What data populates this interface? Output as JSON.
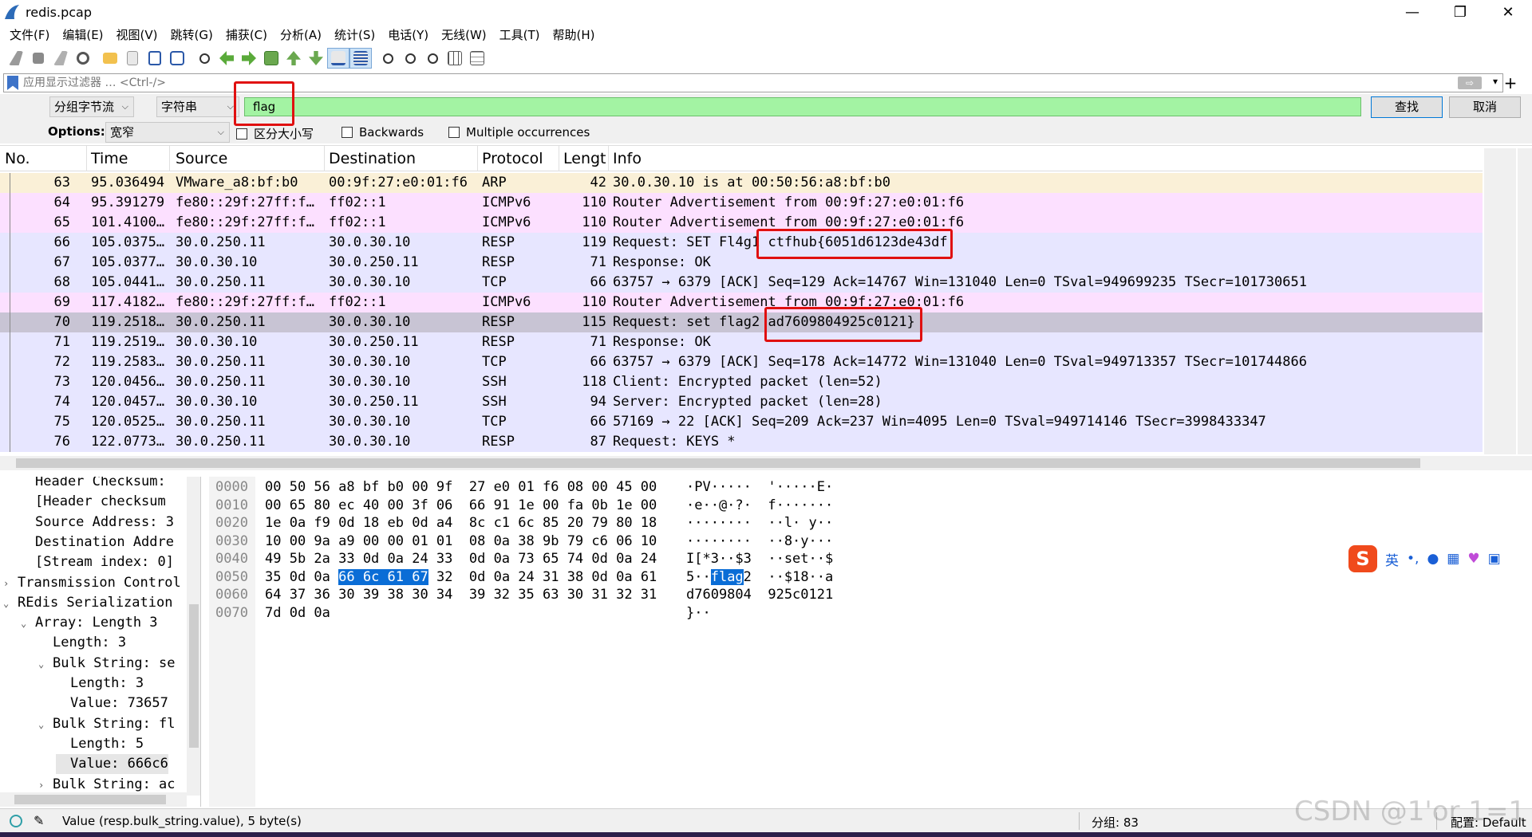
{
  "window": {
    "title": "redis.pcap",
    "controls": [
      "—",
      "❐",
      "✕"
    ]
  },
  "menu": [
    "文件(F)",
    "编辑(E)",
    "视图(V)",
    "跳转(G)",
    "捕获(C)",
    "分析(A)",
    "统计(S)",
    "电话(Y)",
    "无线(W)",
    "工具(T)",
    "帮助(H)"
  ],
  "filter": {
    "placeholder": "应用显示过滤器 … <Ctrl-/>",
    "apply_arrow": "⇨",
    "dropdown": "▾",
    "add": "+"
  },
  "find": {
    "scope": "分组字节流",
    "type": "字符串",
    "query": "flag",
    "find_label": "查找",
    "cancel_label": "取消",
    "options_label": "Options:",
    "charset": "宽窄",
    "case_label": "区分大小写",
    "backwards_label": "Backwards",
    "multiple_label": "Multiple occurrences"
  },
  "columns": [
    "No.",
    "Time",
    "Source",
    "Destination",
    "Protocol",
    "Lengt",
    "Info"
  ],
  "packets": [
    {
      "no": "63",
      "time": "95.036494",
      "src": "VMware_a8:bf:b0",
      "dst": "00:9f:27:e0:01:f6",
      "proto": "ARP",
      "len": "42",
      "info": "30.0.30.10 is at 00:50:56:a8:bf:b0",
      "bg": "#faf0d7"
    },
    {
      "no": "64",
      "time": "95.391279",
      "src": "fe80::29f:27ff:f…",
      "dst": "ff02::1",
      "proto": "ICMPv6",
      "len": "110",
      "info": "Router Advertisement from 00:9f:27:e0:01:f6",
      "bg": "#fce0ff"
    },
    {
      "no": "65",
      "time": "101.4100…",
      "src": "fe80::29f:27ff:f…",
      "dst": "ff02::1",
      "proto": "ICMPv6",
      "len": "110",
      "info": "Router Advertisement from 00:9f:27:e0:01:f6",
      "bg": "#fce0ff"
    },
    {
      "no": "66",
      "time": "105.0375…",
      "src": "30.0.250.11",
      "dst": "30.0.30.10",
      "proto": "RESP",
      "len": "119",
      "info": "Request: SET Fl4g1 ctfhub{6051d6123de43df",
      "bg": "#e7e6ff"
    },
    {
      "no": "67",
      "time": "105.0377…",
      "src": "30.0.30.10",
      "dst": "30.0.250.11",
      "proto": "RESP",
      "len": "71",
      "info": "Response: OK",
      "bg": "#e7e6ff"
    },
    {
      "no": "68",
      "time": "105.0441…",
      "src": "30.0.250.11",
      "dst": "30.0.30.10",
      "proto": "TCP",
      "len": "66",
      "info": "63757 → 6379 [ACK] Seq=129 Ack=14767 Win=131040 Len=0 TSval=949699235 TSecr=101730651",
      "bg": "#e7e6ff"
    },
    {
      "no": "69",
      "time": "117.4182…",
      "src": "fe80::29f:27ff:f…",
      "dst": "ff02::1",
      "proto": "ICMPv6",
      "len": "110",
      "info": "Router Advertisement from 00:9f:27:e0:01:f6",
      "bg": "#fce0ff"
    },
    {
      "no": "70",
      "time": "119.2518…",
      "src": "30.0.250.11",
      "dst": "30.0.30.10",
      "proto": "RESP",
      "len": "115",
      "info": "Request: set flag2 ad7609804925c0121}",
      "bg": "#c8c4d4"
    },
    {
      "no": "71",
      "time": "119.2519…",
      "src": "30.0.30.10",
      "dst": "30.0.250.11",
      "proto": "RESP",
      "len": "71",
      "info": "Response: OK",
      "bg": "#e7e6ff"
    },
    {
      "no": "72",
      "time": "119.2583…",
      "src": "30.0.250.11",
      "dst": "30.0.30.10",
      "proto": "TCP",
      "len": "66",
      "info": "63757 → 6379 [ACK] Seq=178 Ack=14772 Win=131040 Len=0 TSval=949713357 TSecr=101744866",
      "bg": "#e7e6ff"
    },
    {
      "no": "73",
      "time": "120.0456…",
      "src": "30.0.250.11",
      "dst": "30.0.30.10",
      "proto": "SSH",
      "len": "118",
      "info": "Client: Encrypted packet (len=52)",
      "bg": "#e7e6ff"
    },
    {
      "no": "74",
      "time": "120.0457…",
      "src": "30.0.30.10",
      "dst": "30.0.250.11",
      "proto": "SSH",
      "len": "94",
      "info": "Server: Encrypted packet (len=28)",
      "bg": "#e7e6ff"
    },
    {
      "no": "75",
      "time": "120.0525…",
      "src": "30.0.250.11",
      "dst": "30.0.30.10",
      "proto": "TCP",
      "len": "66",
      "info": "57169 → 22 [ACK] Seq=209 Ack=237 Win=4095 Len=0 TSval=949714146 TSecr=3998433347",
      "bg": "#e7e6ff"
    },
    {
      "no": "76",
      "time": "122.0773…",
      "src": "30.0.250.11",
      "dst": "30.0.30.10",
      "proto": "RESP",
      "len": "87",
      "info": "Request: KEYS *",
      "bg": "#e7e6ff"
    }
  ],
  "details": [
    {
      "indent": 2,
      "arrow": "",
      "text": "Header Checksum: "
    },
    {
      "indent": 2,
      "arrow": "",
      "text": "[Header checksum"
    },
    {
      "indent": 2,
      "arrow": "",
      "text": "Source Address: 3"
    },
    {
      "indent": 2,
      "arrow": "",
      "text": "Destination Addre"
    },
    {
      "indent": 2,
      "arrow": "",
      "text": "[Stream index: 0]"
    },
    {
      "indent": 1,
      "arrow": "›",
      "text": "Transmission Control"
    },
    {
      "indent": 1,
      "arrow": "⌄",
      "text": "REdis Serialization"
    },
    {
      "indent": 2,
      "arrow": "⌄",
      "text": "Array: Length 3"
    },
    {
      "indent": 3,
      "arrow": "",
      "text": "Length: 3"
    },
    {
      "indent": 3,
      "arrow": "⌄",
      "text": "Bulk String: se"
    },
    {
      "indent": 4,
      "arrow": "",
      "text": "Length: 3"
    },
    {
      "indent": 4,
      "arrow": "",
      "text": "Value: 73657"
    },
    {
      "indent": 3,
      "arrow": "⌄",
      "text": "Bulk String: fl"
    },
    {
      "indent": 4,
      "arrow": "",
      "text": "Length: 5"
    },
    {
      "indent": 4,
      "arrow": "",
      "text": "Value: 666c6"
    },
    {
      "indent": 3,
      "arrow": "›",
      "text": "Bulk String: ac"
    }
  ],
  "bytes": [
    {
      "off": "0000",
      "hex": "00 50 56 a8 bf b0 00 9f  27 e0 01 f6 08 00 45 00",
      "ascii": "·PV·····  '·····E·"
    },
    {
      "off": "0010",
      "hex": "00 65 80 ec 40 00 3f 06  66 91 1e 00 fa 0b 1e 00",
      "ascii": "·e··@·?·  f·······"
    },
    {
      "off": "0020",
      "hex": "1e 0a f9 0d 18 eb 0d a4  8c c1 6c 85 20 79 80 18",
      "ascii": "········  ··l· y··"
    },
    {
      "off": "0030",
      "hex": "10 00 9a a9 00 00 01 01  08 0a 38 9b 79 c6 06 10",
      "ascii": "········  ··8·y···"
    },
    {
      "off": "0040",
      "hex": "49 5b 2a 33 0d 0a 24 33  0d 0a 73 65 74 0d 0a 24",
      "ascii": "I[*3··$3  ··set··$"
    },
    {
      "off": "0050",
      "hex_pre": "35 0d 0a ",
      "hex_hl": "66 6c 61 67",
      "hex_post": " 32  0d 0a 24 31 38 0d 0a 61",
      "ascii_pre": "5··",
      "ascii_hl": "flag",
      "ascii_post": "2  ··$18··a"
    },
    {
      "off": "0060",
      "hex": "64 37 36 30 39 38 30 34  39 32 35 63 30 31 32 31",
      "ascii": "d7609804  925c0121"
    },
    {
      "off": "0070",
      "hex": "7d 0d 0a",
      "ascii": "}··"
    }
  ],
  "ime": {
    "label": "英",
    "punct": "•,"
  },
  "status": {
    "field": "Value (resp.bulk_string.value), 5 byte(s)",
    "packets": "分组: 83",
    "profile": "配置: Default"
  },
  "watermark": "CSDN @1'or 1=1"
}
